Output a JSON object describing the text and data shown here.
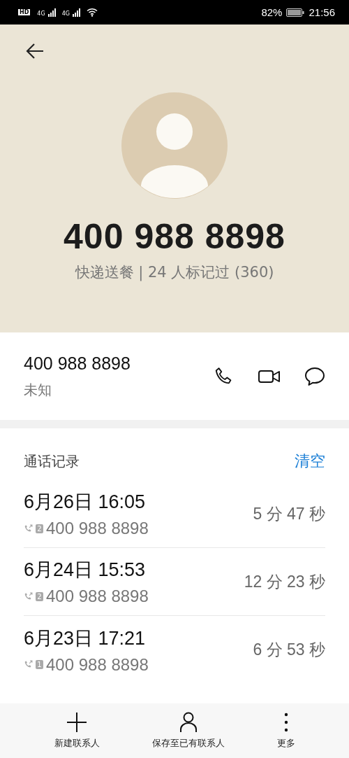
{
  "status_bar": {
    "hd": "HD",
    "networks": [
      "4G",
      "4G"
    ],
    "battery": "82%",
    "time": "21:56"
  },
  "header": {
    "number": "400 988 8898",
    "tag": "快递送餐 | 24 人标记过 (360)"
  },
  "contact": {
    "number": "400 988 8898",
    "location": "未知"
  },
  "call_log": {
    "title": "通话记录",
    "clear": "清空",
    "rows": [
      {
        "date": "6月26日 16:05",
        "sim": "2",
        "number": "400 988 8898",
        "duration": "5 分 47 秒"
      },
      {
        "date": "6月24日 15:53",
        "sim": "2",
        "number": "400 988 8898",
        "duration": "12 分 23 秒"
      },
      {
        "date": "6月23日 17:21",
        "sim": "1",
        "number": "400 988 8898",
        "duration": "6 分 53 秒"
      }
    ]
  },
  "bottom_bar": [
    {
      "kind": "add",
      "label": "新建联系人"
    },
    {
      "kind": "person",
      "label": "保存至已有联系人"
    },
    {
      "kind": "more",
      "label": "更多"
    }
  ]
}
